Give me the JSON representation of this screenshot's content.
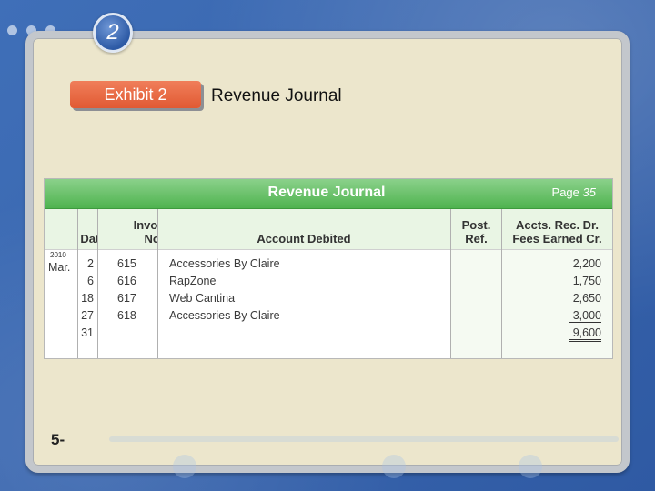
{
  "slide": {
    "badge_number": "2",
    "exhibit_label": "Exhibit 2",
    "exhibit_title": "Revenue Journal",
    "footer_label": "5-"
  },
  "journal": {
    "title": "Revenue Journal",
    "page_label": "Page",
    "page_number": "35",
    "columns": {
      "date": "Date",
      "invoice": "Invoice No.",
      "account": "Account Debited",
      "post_ref": "Post. Ref.",
      "amount": "Accts. Rec. Dr. Fees Earned Cr."
    },
    "year": "2010",
    "month": "Mar.",
    "rows": [
      {
        "day": "2",
        "invoice": "615",
        "account": "Accessories By Claire",
        "amount": "2,200"
      },
      {
        "day": "6",
        "invoice": "616",
        "account": "RapZone",
        "amount": "1,750"
      },
      {
        "day": "18",
        "invoice": "617",
        "account": "Web Cantina",
        "amount": "2,650"
      },
      {
        "day": "27",
        "invoice": "618",
        "account": "Accessories By Claire",
        "amount": "3,000"
      },
      {
        "day": "31",
        "invoice": "",
        "account": "",
        "amount": "9,600"
      }
    ]
  }
}
